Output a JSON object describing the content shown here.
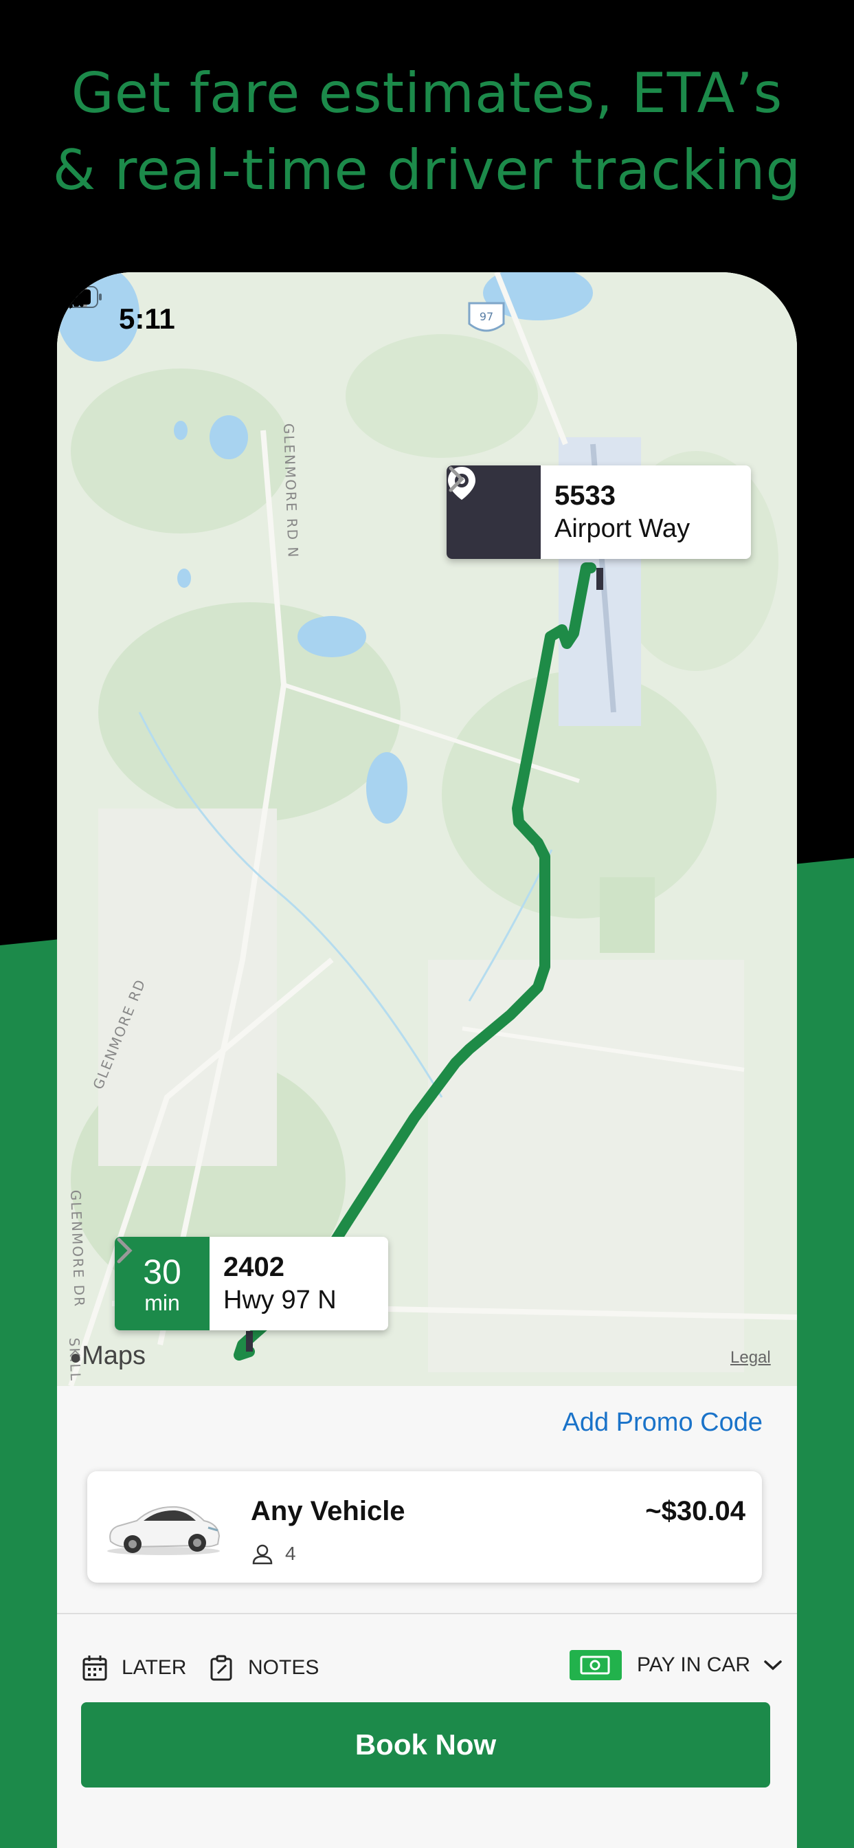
{
  "headline": {
    "line1": "Get fare estimates, ETA’s",
    "line2": "& real-time driver tracking"
  },
  "status_bar": {
    "time": "5:11"
  },
  "map": {
    "highway_shield": "97",
    "road_labels": [
      "GLENMORE RD N",
      "GLENMORE RD",
      "GLENMORE DR",
      "SKILL"
    ],
    "destination": {
      "number": "5533",
      "street": "Airport Way"
    },
    "pickup": {
      "eta_value": "30",
      "eta_unit": "min",
      "number": "2402",
      "street": "Hwy 97 N"
    },
    "maps_attribution": "Maps",
    "legal": "Legal"
  },
  "booking": {
    "promo_label": "Add Promo Code",
    "vehicle": {
      "name": "Any Vehicle",
      "price": "~$30.04",
      "seats": "4"
    },
    "options": {
      "later": "LATER",
      "notes": "NOTES",
      "payment": "PAY IN CAR"
    },
    "book_label": "Book Now"
  },
  "colors": {
    "brand_green": "#1c8a4a",
    "route_green": "#1e8b47",
    "dark_callout": "#33323f",
    "link_blue": "#1a73c9"
  }
}
